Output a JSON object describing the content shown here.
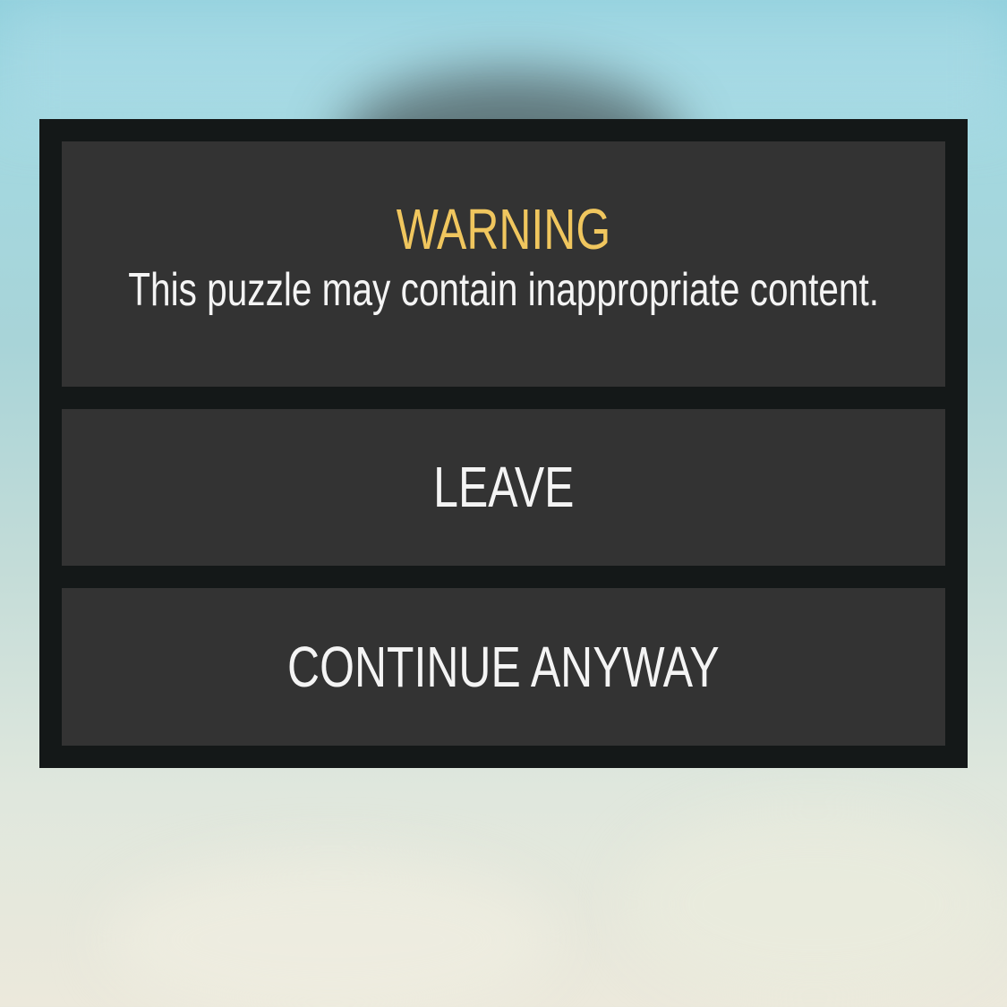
{
  "dialog": {
    "title": "WARNING",
    "message": "This puzzle may contain inappropriate content.",
    "buttons": {
      "leave_label": "LEAVE",
      "continue_label": "CONTINUE ANYWAY"
    }
  },
  "colors": {
    "title_accent": "#f0c65e",
    "panel": "#333333",
    "dialog_frame": "#141818",
    "text": "#f4f4f4"
  }
}
